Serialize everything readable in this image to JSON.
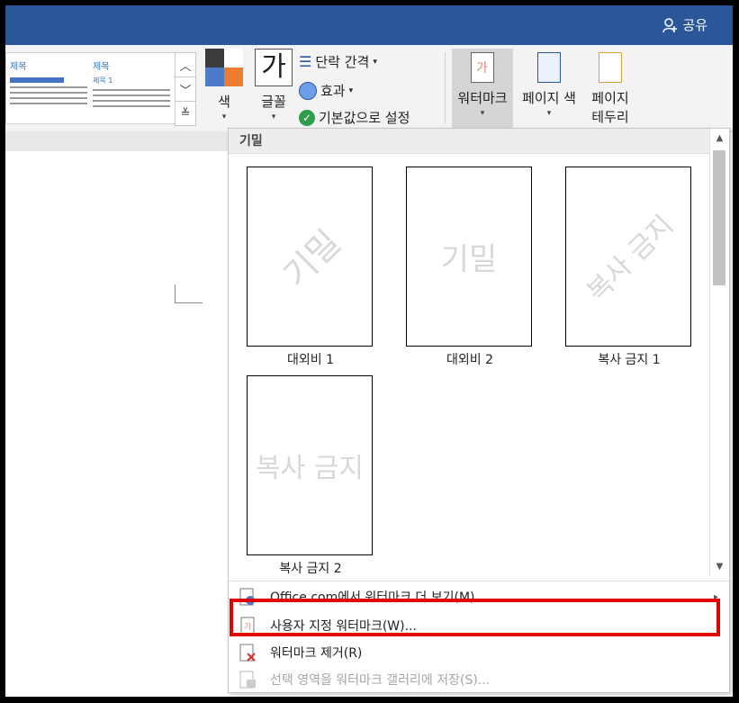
{
  "header": {
    "share_label": "공유"
  },
  "ribbon": {
    "theme_thumb": {
      "title1": "제목",
      "title2": "제목",
      "sub": "제목 1",
      "sub2": "제목 1"
    },
    "colors_label": "색",
    "fonts_glyph": "가",
    "fonts_label": "글꼴",
    "paragraph_spacing_label": "단락 간격",
    "effects_label": "효과",
    "set_default_label": "기본값으로 설정",
    "watermark_label": "워터마크",
    "page_color_label": "페이지 색",
    "page_border_line1": "페이지",
    "page_border_line2": "테두리",
    "color_swatches": [
      "#3b3b3b",
      "#ffffff",
      "#4a7cc9",
      "#ed7d31"
    ],
    "accent": "#2b579a"
  },
  "panel": {
    "category": "기밀",
    "watermarks": [
      {
        "label": "대외비 1",
        "text": "기밀",
        "diagonal": true
      },
      {
        "label": "대외비 2",
        "text": "기밀",
        "diagonal": false
      },
      {
        "label": "복사 금지 1",
        "text": "복사 금지",
        "diagonal": true
      },
      {
        "label": "복사 금지 2",
        "text": "복사 금지",
        "diagonal": false
      }
    ],
    "menu": {
      "more_online": "Office.com에서 워터마크 더 보기(M)",
      "custom": "사용자 지정 워터마크(W)...",
      "remove": "워터마크 제거(R)",
      "save_selection": "선택 영역을 워터마크 갤러리에 저장(S)..."
    }
  }
}
